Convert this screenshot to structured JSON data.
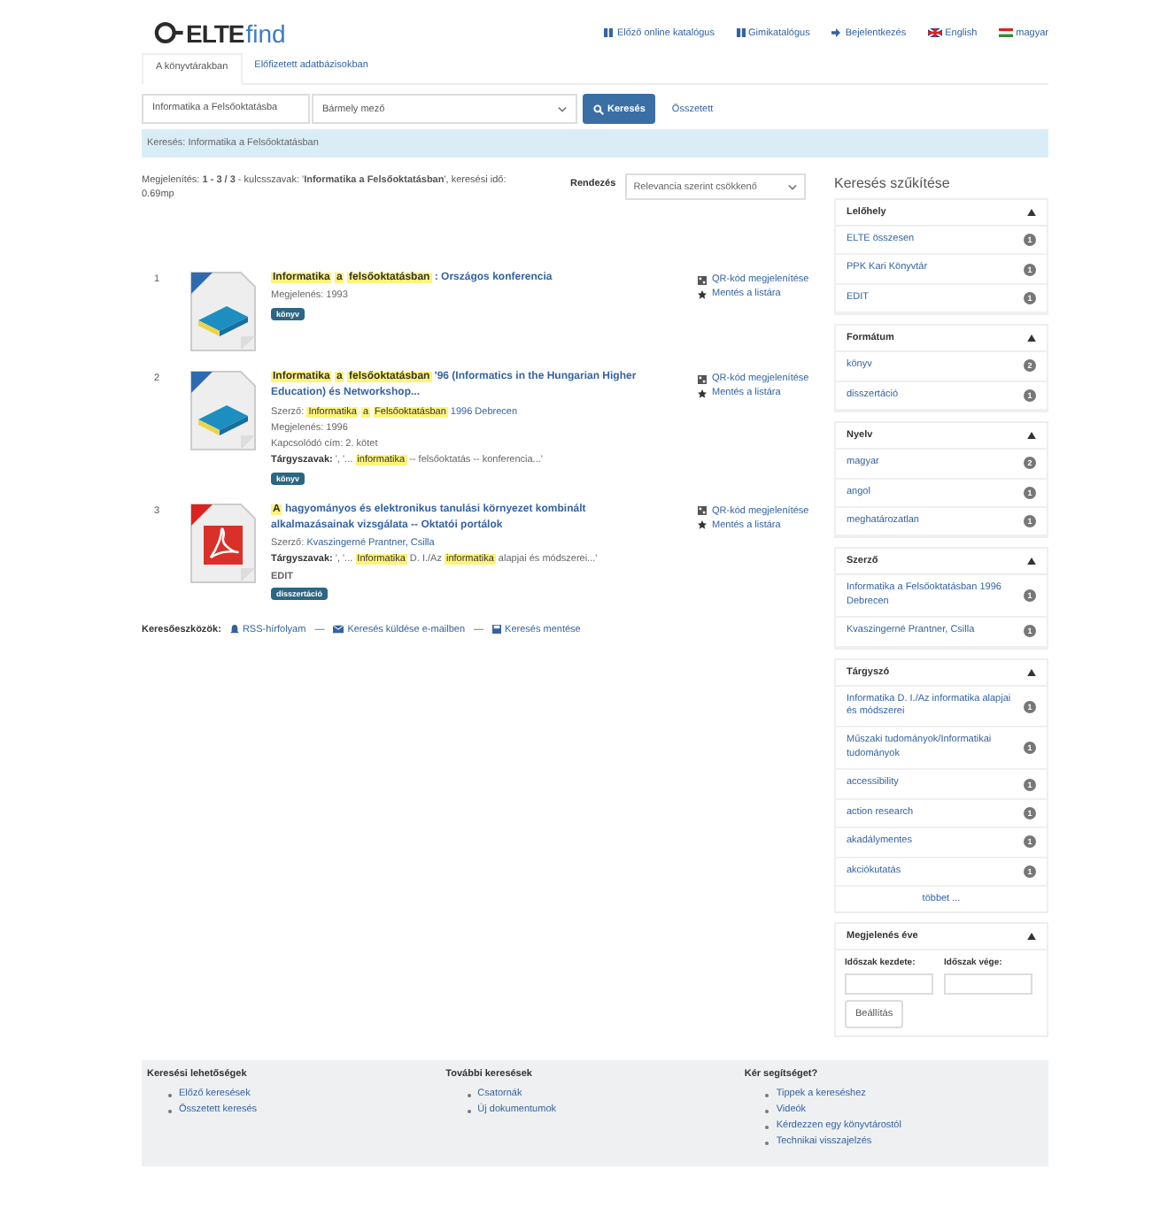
{
  "logo": {
    "part_1": "ELTE",
    "part_2": "find"
  },
  "header_links": [
    {
      "label": "Előző online katalógus",
      "kind": "book"
    },
    {
      "label": "Gimikatalógus",
      "kind": "book"
    },
    {
      "label": "Bejelentkezés",
      "kind": "login"
    },
    {
      "label": "English",
      "kind": "flag-uk"
    },
    {
      "label": "magyar",
      "kind": "flag-hu"
    }
  ],
  "tabs": [
    {
      "label": "A könyvtárakban",
      "selected": true
    },
    {
      "label": "Előfizetett adatbázisokban",
      "selected": false
    }
  ],
  "search": {
    "value": "Informatika a Felsőoktatásba",
    "field": "Bármely mező",
    "button": "Keresés",
    "advanced": "Összetett"
  },
  "breadcrumb": "Keresés: Informatika a Felsőoktatásban",
  "summary": "Megjelenítés: **1 - 3 / 3** - kulcsszavak: '**Informatika a Felsőoktatásban**', keresési idő: 0.69mp",
  "sort": {
    "label": "Rendezés",
    "value": "Relevancia szerint csökkenő"
  },
  "results": [
    {
      "number": "1",
      "kind": "book",
      "title": [
        {
          "text": "Informatika",
          "highlight": true
        },
        {
          "text": "a",
          "highlight": true
        },
        {
          "text": "felsőoktatásban",
          "highlight": true
        },
        {
          "text": ": Országos konferencia",
          "highlight": false
        }
      ],
      "fields": [
        {
          "kind": "plain",
          "label": "Megjelenés: 1993"
        }
      ],
      "format": "könyv",
      "actions": [
        "QR-kód megjelenítése",
        "Mentés a listára"
      ]
    },
    {
      "number": "2",
      "kind": "book",
      "title": [
        {
          "text": "Informatika",
          "highlight": true
        },
        {
          "text": "a",
          "highlight": true
        },
        {
          "text": "felsőoktatásban",
          "highlight": true
        },
        {
          "text": "'96 (Informatics in the Hungarian Higher Education) és Networkshop...",
          "highlight": false
        }
      ],
      "fields": [
        {
          "kind": "author",
          "label": "Szerző:",
          "segments": [
            {
              "text": "Informatika",
              "highlight": true
            },
            {
              "text": "a",
              "highlight": true
            },
            {
              "text": "Felsőoktatásban",
              "highlight": true
            },
            {
              "text": "1996 Debrecen",
              "highlight": false
            }
          ]
        },
        {
          "kind": "plain",
          "label": "Megjelenés: 1996"
        },
        {
          "kind": "plain",
          "label": "Kapcsolódó cím: 2. kötet"
        },
        {
          "kind": "subjects",
          "label": "Tárgyszavak:",
          "segments": [
            {
              "text": "', '...",
              "highlight": false
            },
            {
              "text": "informatika",
              "highlight": true
            },
            {
              "text": "-- felsőoktatás -- konferencia...'",
              "highlight": false
            }
          ]
        }
      ],
      "format": "könyv",
      "actions": [
        "QR-kód megjelenítése",
        "Mentés a listára"
      ]
    },
    {
      "number": "3",
      "kind": "pdf",
      "title": [
        {
          "text": "A",
          "highlight": true
        },
        {
          "text": "hagyományos és elektronikus tanulási környezet kombinált alkalmazásainak vizsgálata -- Oktatói portálok",
          "highlight": false
        }
      ],
      "fields": [
        {
          "kind": "author",
          "label": "Szerző:",
          "segments": [
            {
              "text": "Kvaszingerné Prantner, Csilla",
              "highlight": false
            }
          ]
        },
        {
          "kind": "subjects",
          "label": "Tárgyszavak:",
          "segments": [
            {
              "text": "', '...",
              "highlight": false
            },
            {
              "text": "Informatika",
              "highlight": true
            },
            {
              "text": "D. I./Az",
              "highlight": false
            },
            {
              "text": "informatika",
              "highlight": true
            },
            {
              "text": "alapjai és módszerei...'",
              "highlight": false
            }
          ]
        },
        {
          "kind": "link",
          "label": "EDIT"
        }
      ],
      "format": "disszertáció",
      "actions": [
        "QR-kód megjelenítése",
        "Mentés a listára"
      ]
    }
  ],
  "tools": {
    "label": "Keresőeszközök:",
    "items": [
      {
        "label": "RSS-hírfolyam",
        "kind": "rss"
      },
      {
        "label": "Keresés küldése e-mailben",
        "kind": "mail"
      },
      {
        "label": "Keresés mentése",
        "kind": "save"
      }
    ],
    "separator": "—"
  },
  "sidebar_title": "Keresés szűkítése",
  "facets": [
    {
      "title": "Lelőhely",
      "expanded": true,
      "items": [
        {
          "label": "ELTE összesen",
          "count": "1"
        },
        {
          "label": "PPK Kari Könyvtár",
          "count": "1"
        },
        {
          "label": "EDIT",
          "count": "1"
        }
      ]
    },
    {
      "title": "Formátum",
      "expanded": true,
      "items": [
        {
          "label": "könyv",
          "count": "2"
        },
        {
          "label": "disszertáció",
          "count": "1"
        }
      ]
    },
    {
      "title": "Nyelv",
      "expanded": true,
      "items": [
        {
          "label": "magyar",
          "count": "2"
        },
        {
          "label": "angol",
          "count": "1"
        },
        {
          "label": "meghatározatlan",
          "count": "1"
        }
      ]
    },
    {
      "title": "Szerző",
      "expanded": true,
      "items": [
        {
          "label": "Informatika a Felsőoktatásban 1996 Debrecen",
          "count": "1"
        },
        {
          "label": "Kvaszingerné Prantner, Csilla",
          "count": "1"
        }
      ]
    },
    {
      "title": "Tárgyszó",
      "expanded": true,
      "items": [
        {
          "label": "Informatika D. I./Az informatika alapjai és módszerei",
          "count": "1"
        },
        {
          "label": "Műszaki tudományok/Informatikai tudományok",
          "count": "1"
        },
        {
          "label": "accessibility",
          "count": "1"
        },
        {
          "label": "action research",
          "count": "1"
        },
        {
          "label": "akadálymentes",
          "count": "1"
        },
        {
          "label": "akciókutatás",
          "count": "1"
        }
      ],
      "more": "többet ..."
    }
  ],
  "year_facet": {
    "title": "Megjelenés éve",
    "expanded": true,
    "from_label": "Időszak kezdete:",
    "to_label": "Időszak vége:",
    "button": "Beállítás"
  },
  "footer": [
    {
      "title": "Keresési lehetőségek",
      "links": [
        "Előző keresések",
        "Összetett keresés"
      ]
    },
    {
      "title": "További keresések",
      "links": [
        "Csatornák",
        "Új dokumentumok"
      ]
    },
    {
      "title": "Kér segítséget?",
      "links": [
        "Tippek a kereséshez",
        "Videók",
        "Kérdezzen egy könyvtárostól",
        "Technikai visszajelzés"
      ]
    }
  ]
}
